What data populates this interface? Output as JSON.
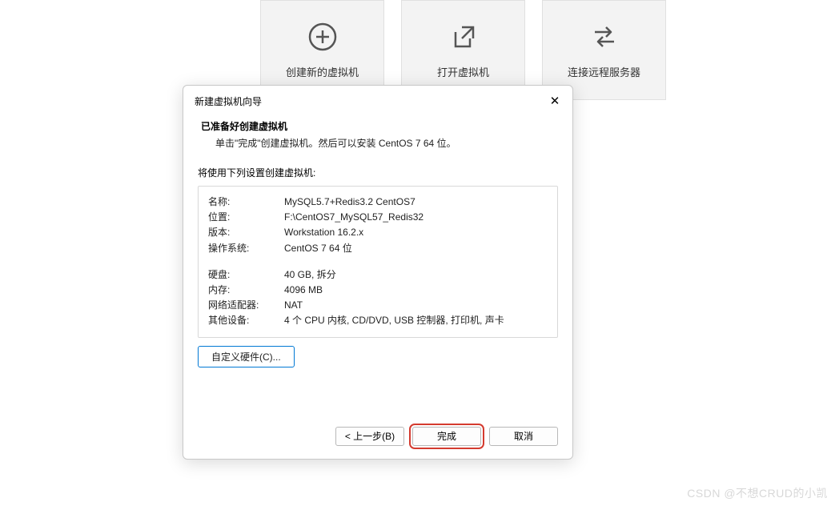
{
  "tiles": {
    "create": "创建新的虚拟机",
    "open": "打开虚拟机",
    "connect": "连接远程服务器"
  },
  "dialog": {
    "title": "新建虚拟机向导",
    "heading": "已准备好创建虚拟机",
    "subheading": "单击\"完成\"创建虚拟机。然后可以安装 CentOS 7 64 位。",
    "intro": "将使用下列设置创建虚拟机:",
    "rows": {
      "name_l": "名称:",
      "name_v": "MySQL5.7+Redis3.2 CentOS7",
      "loc_l": "位置:",
      "loc_v": "F:\\CentOS7_MySQL57_Redis32",
      "ver_l": "版本:",
      "ver_v": "Workstation 16.2.x",
      "os_l": "操作系统:",
      "os_v": "CentOS 7 64 位",
      "disk_l": "硬盘:",
      "disk_v": "40 GB, 拆分",
      "mem_l": "内存:",
      "mem_v": "4096 MB",
      "net_l": "网络适配器:",
      "net_v": "NAT",
      "oth_l": "其他设备:",
      "oth_v": "4 个 CPU 内核, CD/DVD, USB 控制器, 打印机, 声卡"
    },
    "customize": "自定义硬件(C)...",
    "back": "< 上一步(B)",
    "finish": "完成",
    "cancel": "取消"
  },
  "watermark": "CSDN @不想CRUD的小凯"
}
